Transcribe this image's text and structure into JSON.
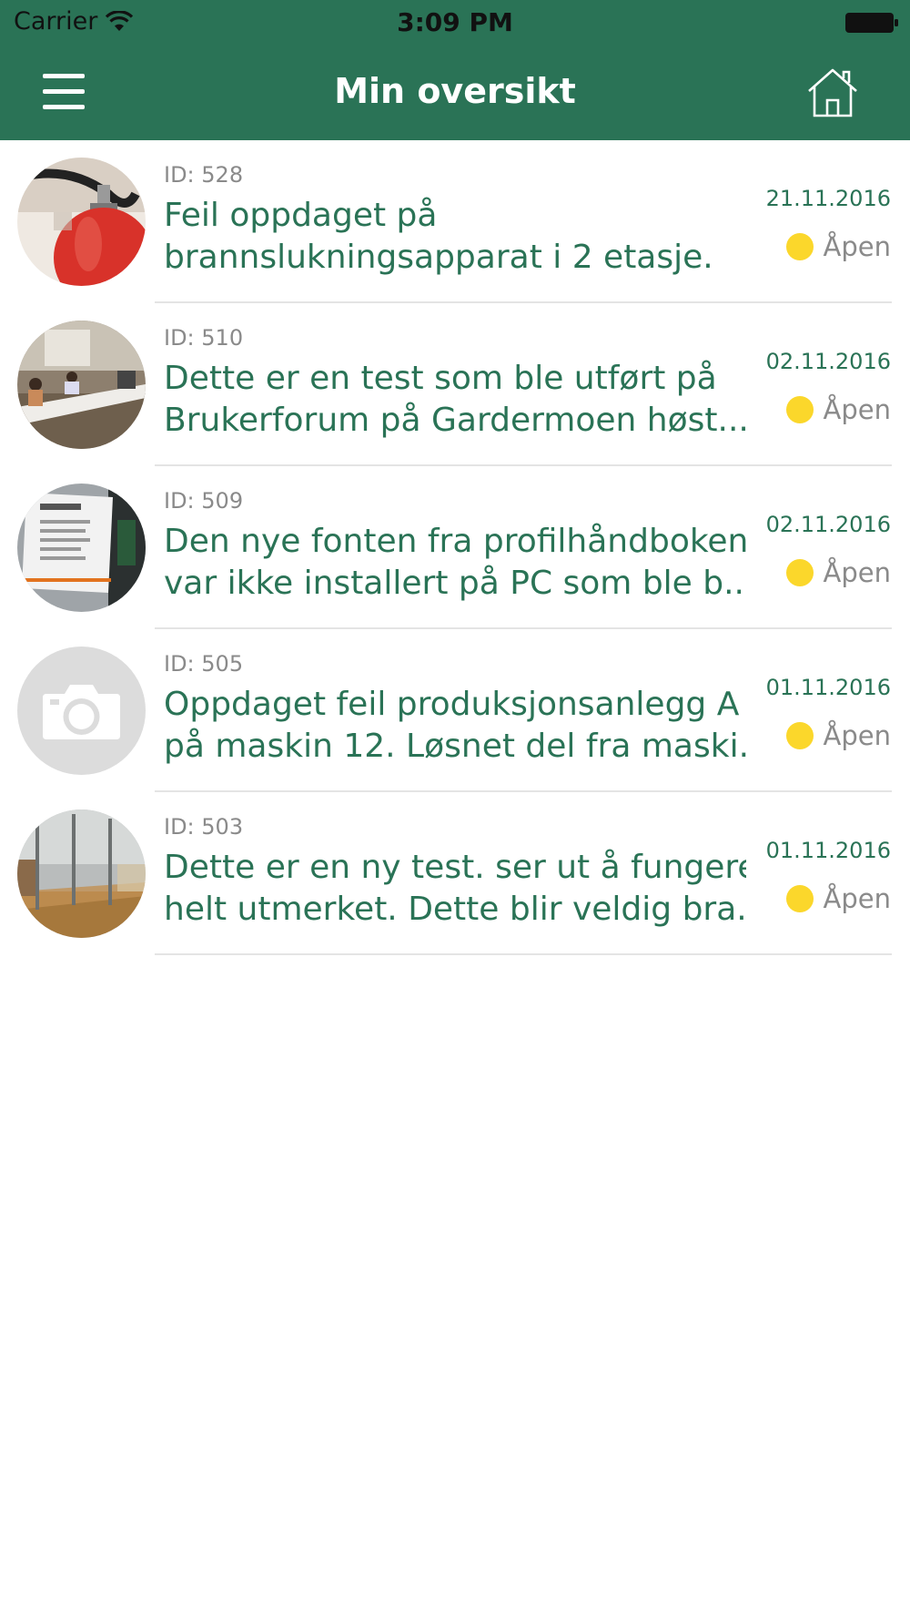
{
  "status_bar": {
    "carrier": "Carrier",
    "time": "3:09 PM"
  },
  "header": {
    "title": "Min oversikt",
    "menu_icon": "hamburger-menu-icon",
    "home_icon": "home-icon"
  },
  "colors": {
    "header_bg": "#2a7356",
    "accent_text": "#2a7356",
    "status_open": "#fbd72b"
  },
  "items": [
    {
      "id_label": "ID: 528",
      "line1": "Feil oppdaget på",
      "line2": "brannslukningsapparat i 2 etasje.",
      "date": "21.11.2016",
      "status": "Åpen",
      "thumbnail": "fire-extinguisher-photo"
    },
    {
      "id_label": "ID: 510",
      "line1": "Dette er en test som ble utført på",
      "line2": "Brukerforum på Gardermoen høst...",
      "date": "02.11.2016",
      "status": "Åpen",
      "thumbnail": "meeting-room-photo"
    },
    {
      "id_label": "ID: 509",
      "line1": "Den nye fonten fra profilhåndboken",
      "line2": "var ikke installert på PC som ble b...",
      "date": "02.11.2016",
      "status": "Åpen",
      "thumbnail": "presentation-screen-photo"
    },
    {
      "id_label": "ID: 505",
      "line1": "Oppdaget feil produksjonsanlegg A",
      "line2": "på maskin 12. Løsnet del fra maski...",
      "date": "01.11.2016",
      "status": "Åpen",
      "thumbnail": "camera-placeholder-icon"
    },
    {
      "id_label": "ID: 503",
      "line1": "Dette er en ny test. ser ut å fungere",
      "line2": "helt utmerket. Dette blir veldig bra.",
      "date": "01.11.2016",
      "status": "Åpen",
      "thumbnail": "glass-wall-photo"
    }
  ]
}
